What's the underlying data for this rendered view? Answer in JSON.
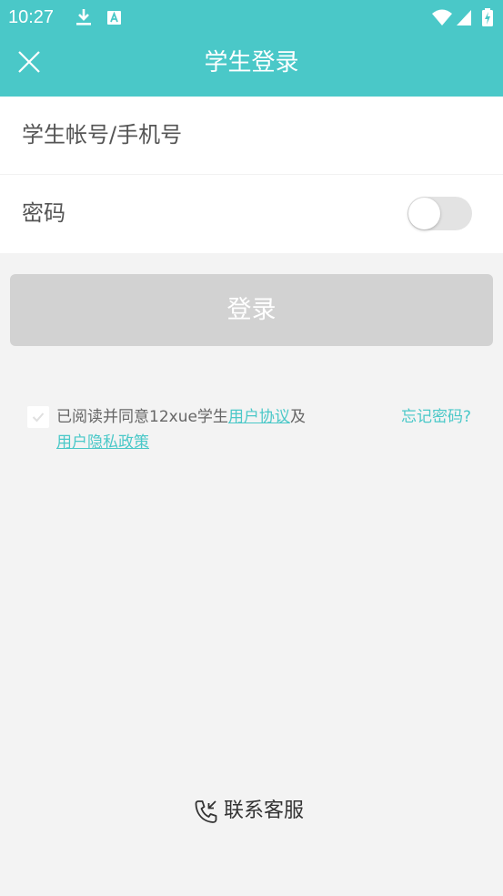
{
  "status_bar": {
    "time": "10:27",
    "icons": [
      "download-icon",
      "text-a-icon",
      "wifi-icon",
      "signal-icon",
      "battery-charging-icon"
    ]
  },
  "header": {
    "title": "学生登录",
    "close_icon": "close-icon"
  },
  "form": {
    "account_placeholder": "学生帐号/手机号",
    "password_label": "密码",
    "password_visibility_toggle": "off"
  },
  "login_button": {
    "label": "登录"
  },
  "agreement": {
    "checked": true,
    "prefix": "已阅读并同意12xue学生",
    "user_agreement_link": "用户协议",
    "conjunction": "及",
    "privacy_policy_link": "用户隐私政策"
  },
  "forgot_password": {
    "label": "忘记密码?"
  },
  "contact": {
    "label": "联系客服",
    "icon": "phone-callback-icon"
  },
  "colors": {
    "accent": "#4ac8c8",
    "background": "#f3f3f3",
    "button_disabled": "#d2d2d2"
  }
}
